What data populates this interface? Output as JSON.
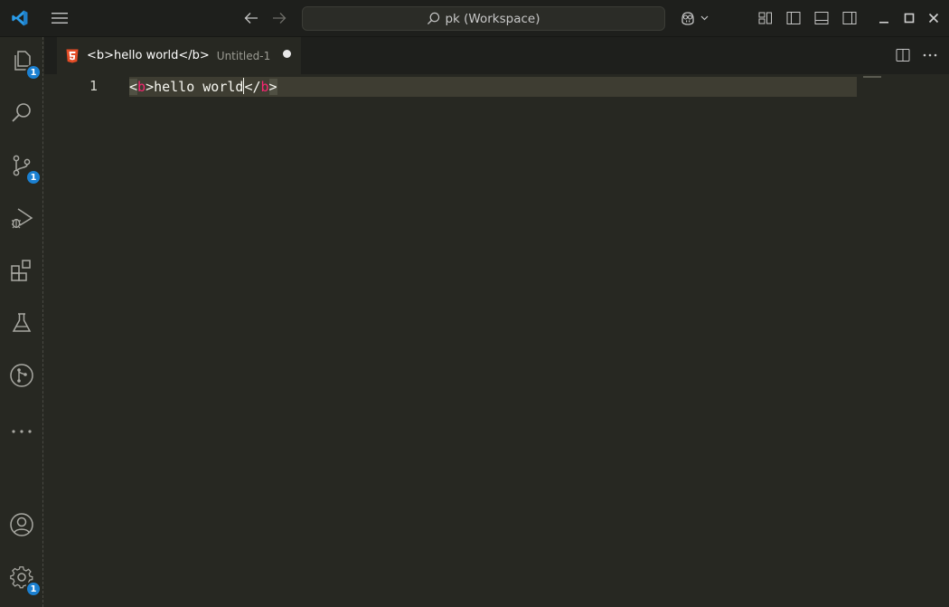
{
  "title_bar": {
    "search_text": "pk (Workspace)"
  },
  "activity_bar": {
    "items": [
      {
        "name": "Explorer",
        "badge": "1"
      },
      {
        "name": "Search",
        "badge": ""
      },
      {
        "name": "Source Control",
        "badge": "1"
      },
      {
        "name": "Run and Debug",
        "badge": ""
      },
      {
        "name": "Extensions",
        "badge": ""
      },
      {
        "name": "Testing",
        "badge": ""
      },
      {
        "name": "Git Graph",
        "badge": ""
      },
      {
        "name": "More",
        "badge": ""
      }
    ],
    "accounts_badge": "",
    "manage_badge": "1"
  },
  "tab": {
    "title": "<b>hello world</b>",
    "description": "Untitled-1",
    "dirty": true
  },
  "editor": {
    "line_number": "1",
    "code": {
      "open_lt": "<",
      "open_tag": "b",
      "open_gt": ">",
      "text": "hello world",
      "close_lt": "</",
      "close_tag": "b",
      "close_gt": ">"
    }
  },
  "colors": {
    "editor_bg": "#272822",
    "titlebar_bg": "#1e1f1c",
    "current_line": "#3e3d32",
    "tag": "#f92672",
    "badge": "#1b80d1",
    "html_icon": "#e34c26"
  }
}
